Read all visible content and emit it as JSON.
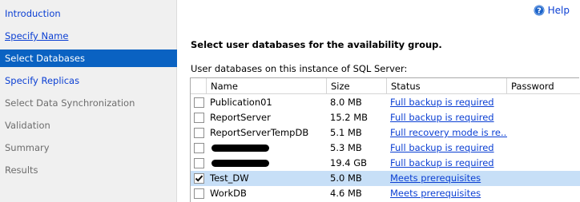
{
  "sidebar": {
    "items": [
      {
        "label": "Introduction",
        "state": "link"
      },
      {
        "label": "Specify Name",
        "state": "link-underline"
      },
      {
        "label": "Select Databases",
        "state": "selected"
      },
      {
        "label": "Specify Replicas",
        "state": "link"
      },
      {
        "label": "Select Data Synchronization",
        "state": "disabled"
      },
      {
        "label": "Validation",
        "state": "disabled"
      },
      {
        "label": "Summary",
        "state": "disabled"
      },
      {
        "label": "Results",
        "state": "disabled"
      }
    ]
  },
  "help": {
    "label": "Help",
    "icon": "help-icon"
  },
  "main": {
    "heading": "Select user databases for the availability group.",
    "subheading": "User databases on this instance of SQL Server:"
  },
  "grid": {
    "columns": [
      "",
      "Name",
      "Size",
      "Status",
      "Password"
    ],
    "rows": [
      {
        "checked": false,
        "name": "Publication01",
        "size": "8.0 MB",
        "status": "Full backup is required",
        "password": "",
        "selected": false,
        "redacted": false
      },
      {
        "checked": false,
        "name": "ReportServer",
        "size": "15.2 MB",
        "status": "Full backup is required",
        "password": "",
        "selected": false,
        "redacted": false
      },
      {
        "checked": false,
        "name": "ReportServerTempDB",
        "size": "5.1 MB",
        "status": "Full recovery mode is re...",
        "password": "",
        "selected": false,
        "redacted": false
      },
      {
        "checked": false,
        "name": "",
        "size": "5.3 MB",
        "status": "Full backup is required",
        "password": "",
        "selected": false,
        "redacted": true
      },
      {
        "checked": false,
        "name": "",
        "size": "19.4 GB",
        "status": "Full backup is required",
        "password": "",
        "selected": false,
        "redacted": true
      },
      {
        "checked": true,
        "name": "Test_DW",
        "size": "5.0 MB",
        "status": "Meets prerequisites",
        "password": "",
        "selected": true,
        "redacted": false
      },
      {
        "checked": false,
        "name": "WorkDB",
        "size": "4.6 MB",
        "status": "Meets prerequisites",
        "password": "",
        "selected": false,
        "redacted": false
      }
    ]
  }
}
